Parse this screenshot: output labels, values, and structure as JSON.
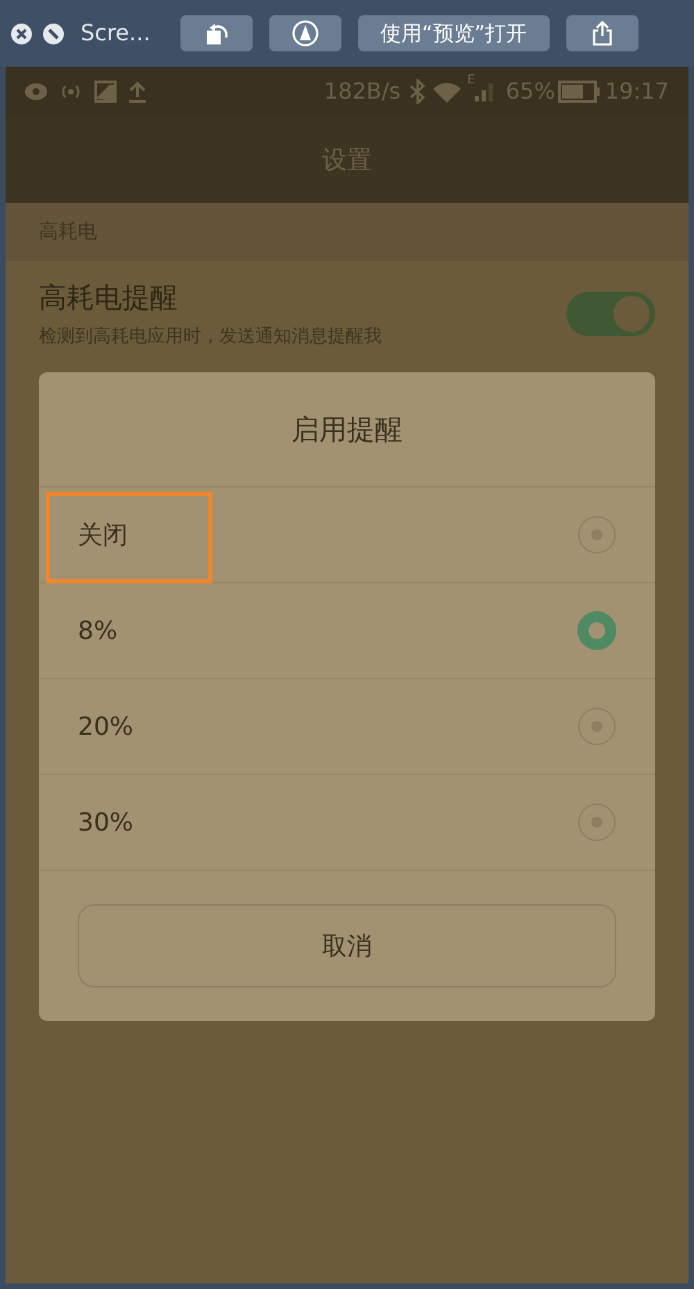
{
  "window": {
    "title": "Scre...",
    "buttons": [
      {
        "kind": "rotate"
      },
      {
        "kind": "markup"
      },
      {
        "kind": "text",
        "label": "使用“预览”打开"
      },
      {
        "kind": "share"
      }
    ]
  },
  "status_bar": {
    "speed": "182B/s",
    "network": "E",
    "battery": "65%",
    "time": "19:17"
  },
  "page_title": "设置",
  "section": "高耗电",
  "setting": {
    "title": "高耗电提醒",
    "description": "检测到高耗电应用时，发送通知消息提醒我",
    "on": true
  },
  "dialog": {
    "title": "启用提醒",
    "options": [
      {
        "label": "关闭",
        "selected": false,
        "highlighted": true
      },
      {
        "label": "8%",
        "selected": true,
        "highlighted": false
      },
      {
        "label": "20%",
        "selected": false,
        "highlighted": false
      },
      {
        "label": "30%",
        "selected": false,
        "highlighted": false
      }
    ],
    "cancel": "取消"
  }
}
